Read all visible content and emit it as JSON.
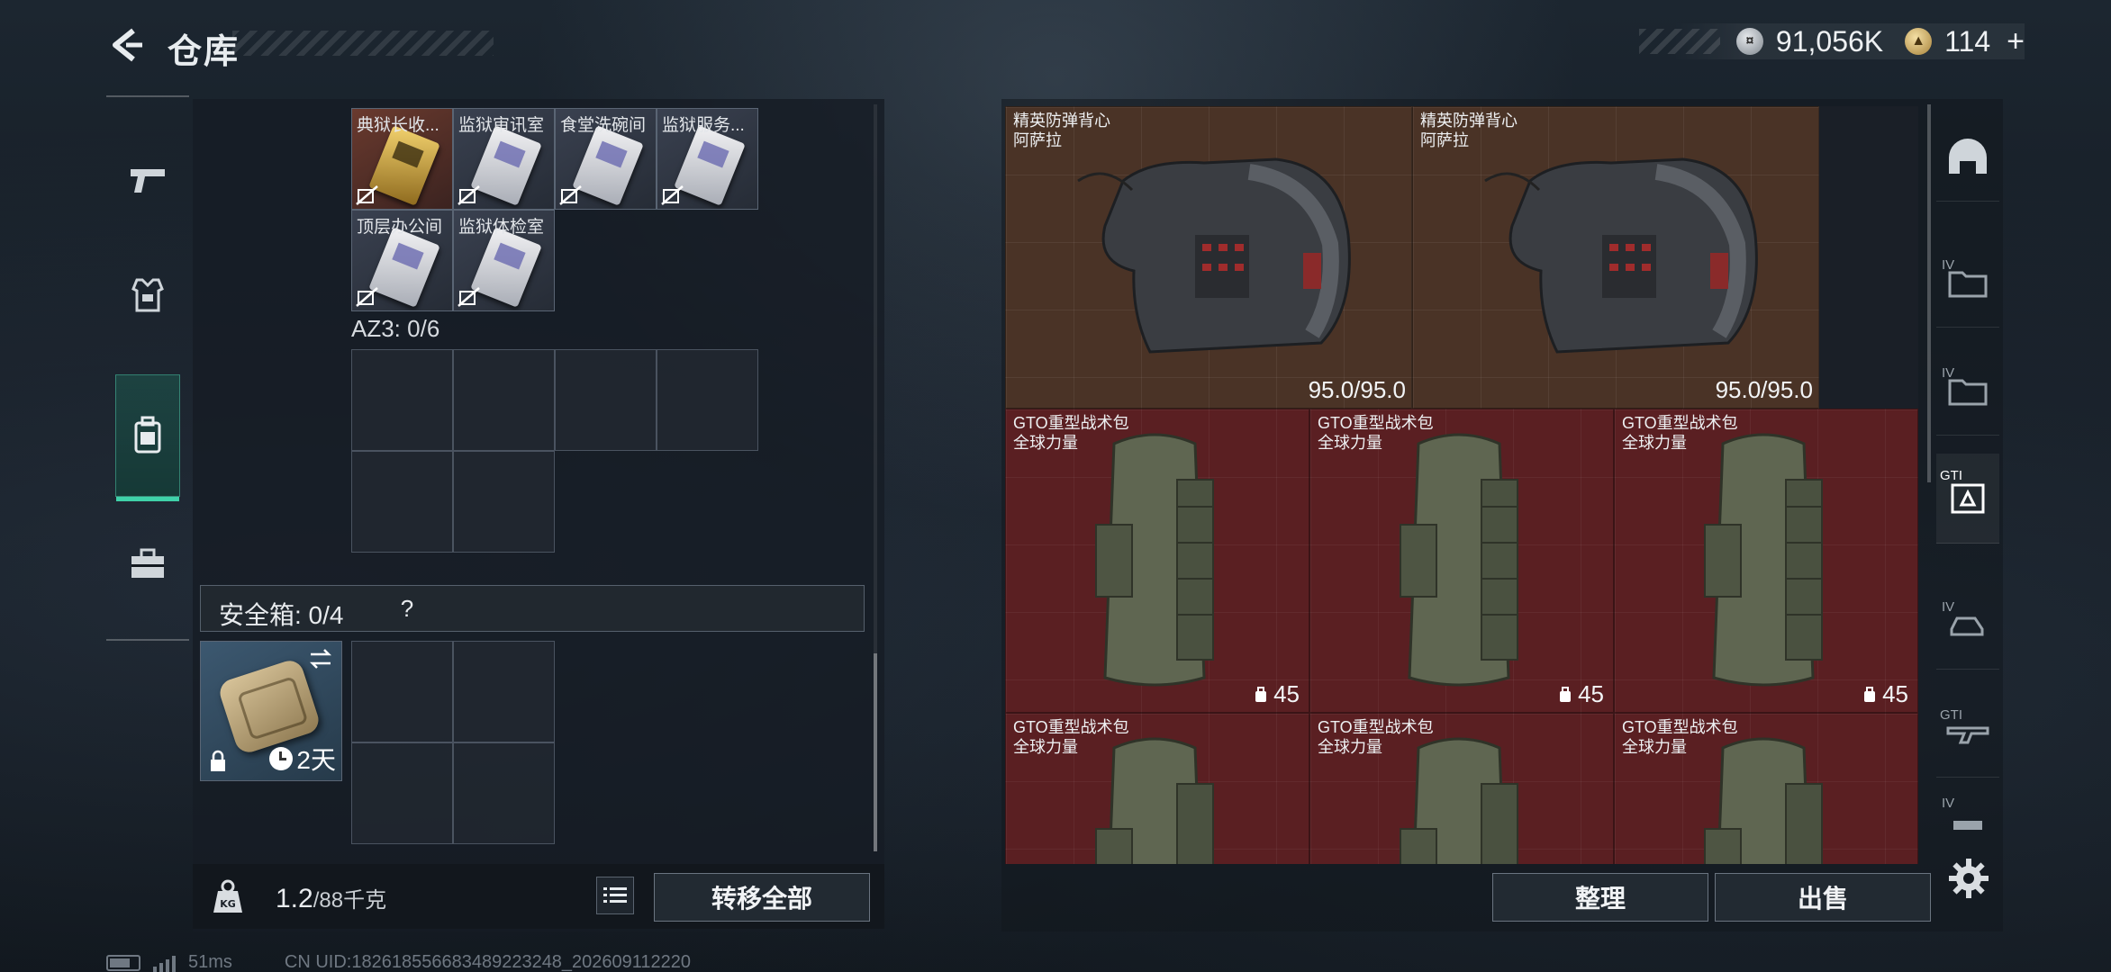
{
  "header": {
    "title": "仓库",
    "currency_silver": "91,056K",
    "currency_gold": "114",
    "add_symbol": "+"
  },
  "left_nav": [
    "weapon-tab",
    "armor-tab",
    "container-tab",
    "toolbox-tab"
  ],
  "cards": [
    {
      "label": "典狱长收..."
    },
    {
      "label": "监狱审讯室"
    },
    {
      "label": "食堂洗碗间"
    },
    {
      "label": "监狱服务..."
    },
    {
      "label": "顶层办公间"
    },
    {
      "label": "监狱体检室"
    }
  ],
  "az3": {
    "label": "AZ3: 0/6"
  },
  "safe": {
    "label": "安全箱: 0/4",
    "help": "?",
    "timer": "2天"
  },
  "weight": {
    "current": "1.2",
    "max": "/88千克"
  },
  "buttons": {
    "transfer_all": "转移全部",
    "sort": "整理",
    "sell": "出售"
  },
  "items": [
    {
      "name1": "精英防弹背心",
      "name2": "阿萨拉",
      "durability": "95.0/95.0"
    },
    {
      "name1": "精英防弹背心",
      "name2": "阿萨拉",
      "durability": "95.0/95.0"
    },
    {
      "name1": "GTO重型战术包",
      "name2": "全球力量",
      "capacity": "45"
    },
    {
      "name1": "GTO重型战术包",
      "name2": "全球力量",
      "capacity": "45"
    },
    {
      "name1": "GTO重型战术包",
      "name2": "全球力量",
      "capacity": "45"
    },
    {
      "name1": "GTO重型战术包",
      "name2": "全球力量"
    },
    {
      "name1": "GTO重型战术包",
      "name2": "全球力量"
    },
    {
      "name1": "GTO重型战术包",
      "name2": "全球力量"
    }
  ],
  "right_nav_labels": [
    "IV",
    "IV",
    "GTI",
    "IV",
    "GTI",
    "IV"
  ],
  "status": {
    "ping": "51ms",
    "uid": "CN UID:182618556683489223248_202609112220"
  },
  "colors": {
    "accent": "#3fd1a9",
    "vest_bg": "#4a3326",
    "bag_bg": "#5a1f22"
  }
}
